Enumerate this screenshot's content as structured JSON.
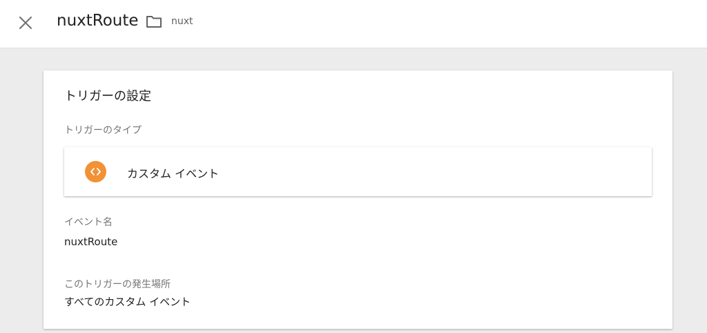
{
  "header": {
    "title": "nuxtRoute",
    "folder_name": "nuxt",
    "close_icon": "close-icon",
    "folder_icon": "folder-icon"
  },
  "card": {
    "heading": "トリガーの設定",
    "trigger_type": {
      "label": "トリガーのタイプ",
      "value": "カスタム イベント",
      "icon": "code-icon",
      "icon_color": "#f09235"
    },
    "event_name": {
      "label": "イベント名",
      "value": "nuxtRoute"
    },
    "fires_on": {
      "label": "このトリガーの発生場所",
      "value": "すべてのカスタム イベント"
    }
  }
}
